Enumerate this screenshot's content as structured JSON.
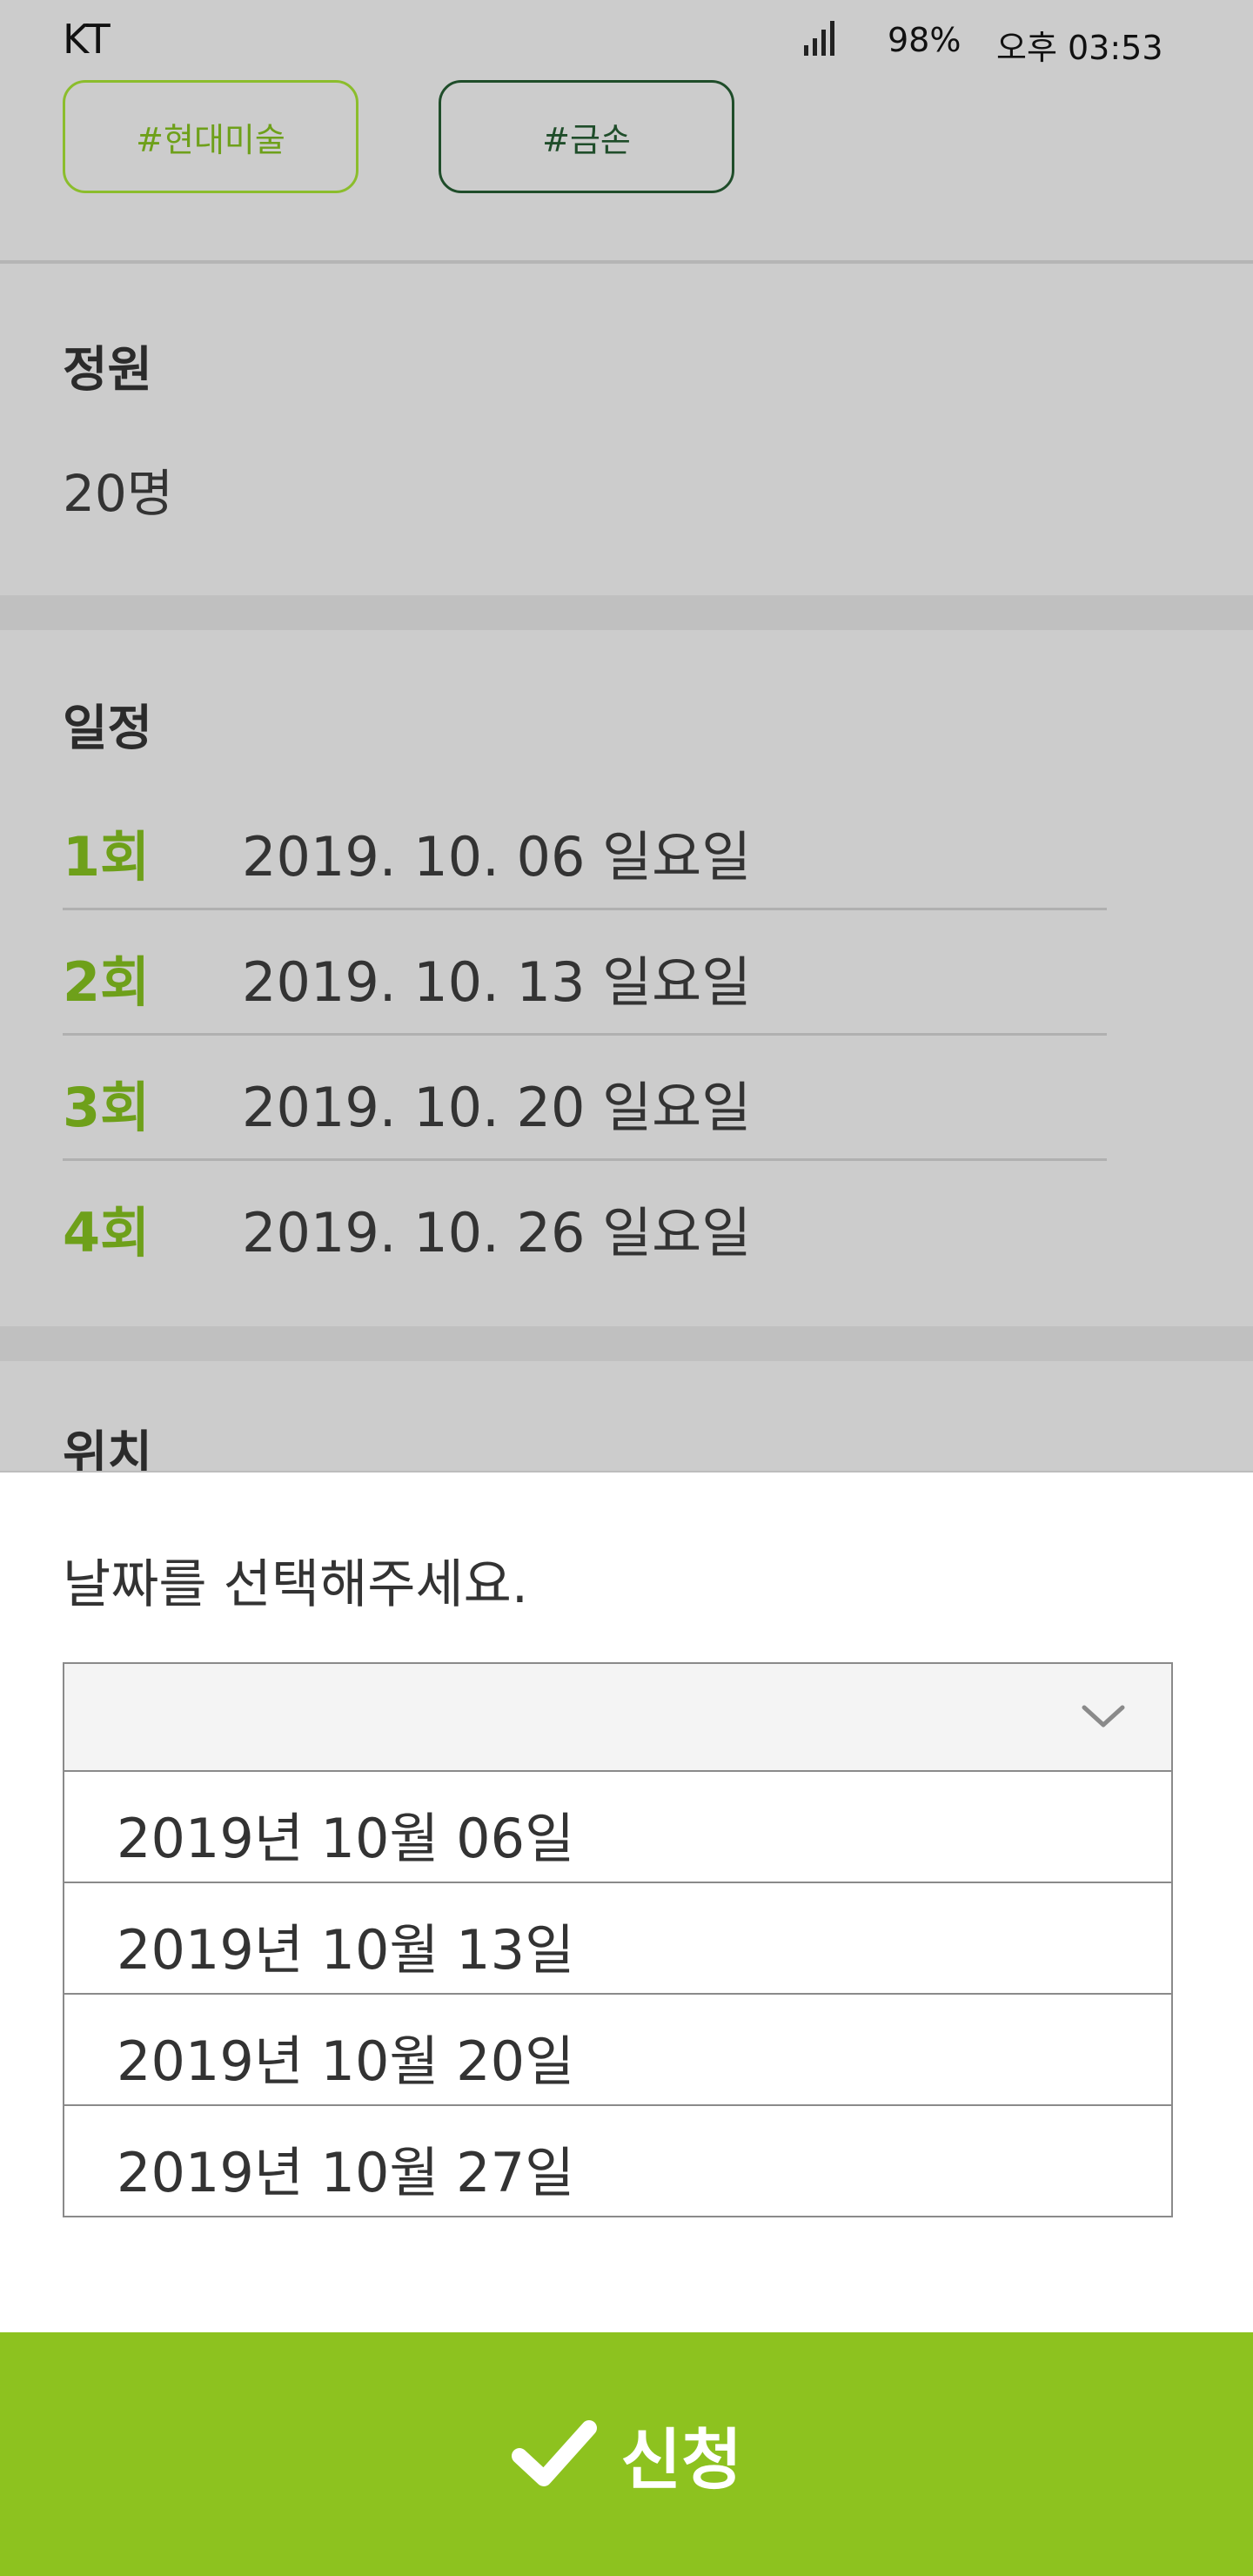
{
  "status_bar": {
    "carrier": "KT",
    "battery": "98%",
    "time": "오후 03:53"
  },
  "tags": [
    "#현대미술",
    "#금손"
  ],
  "capacity": {
    "label": "정원",
    "value": "20명"
  },
  "schedule": {
    "label": "일정",
    "rows": [
      {
        "num": "1회",
        "date": "2019. 10. 06 일요일"
      },
      {
        "num": "2회",
        "date": "2019. 10. 13 일요일"
      },
      {
        "num": "3회",
        "date": "2019. 10. 20 일요일"
      },
      {
        "num": "4회",
        "date": "2019. 10. 26 일요일"
      }
    ]
  },
  "location": {
    "label": "위치"
  },
  "date_sheet": {
    "title": "날짜를 선택해주세요.",
    "selected": "",
    "options": [
      "2019년 10월 06일",
      "2019년 10월 13일",
      "2019년 10월 20일",
      "2019년 10월 27일"
    ]
  },
  "apply_button": {
    "label": "신청",
    "icon": "check-icon"
  },
  "colors": {
    "accent": "#8dc21f",
    "accent_text": "#6ea01a",
    "dark_tag": "#1f4d2a",
    "overlay_bg": "#cccccc"
  }
}
